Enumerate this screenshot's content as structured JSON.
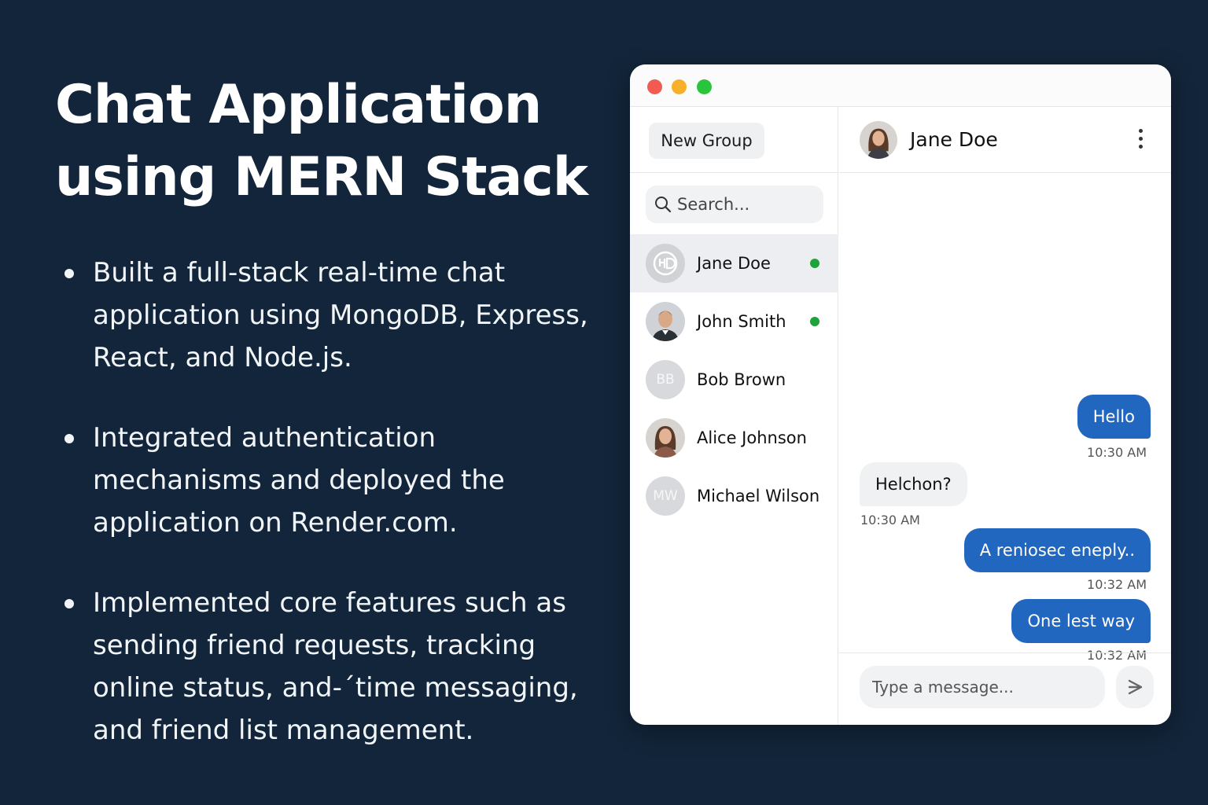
{
  "slide": {
    "title_line1": "Chat Application",
    "title_line2": "using MERN Stack",
    "bullets": [
      "Built a full-stack real-time chat application using MongoDB, Express, React, and Node.js.",
      "Integrated authentication mechanisms and deployed the application on Render.com.",
      "Implemented core features such as sending friend requests, tracking online status, and-´time messaging, and friend list management."
    ]
  },
  "sidebar": {
    "new_group_label": "New Group",
    "search_placeholder": "Search...",
    "contacts": [
      {
        "name": "Jane Doe",
        "online": true,
        "active": true,
        "avatar": "logo-icon"
      },
      {
        "name": "John Smith",
        "online": true,
        "active": false,
        "avatar": "photo"
      },
      {
        "name": "Bob Brown",
        "online": false,
        "active": false,
        "initials": "BB"
      },
      {
        "name": "Alice Johnson",
        "online": false,
        "active": false,
        "avatar": "photo"
      },
      {
        "name": "Michael Wilson",
        "online": false,
        "active": false,
        "initials": "MW"
      }
    ]
  },
  "chat": {
    "contact_name": "Jane Doe",
    "messages": [
      {
        "text": "Hello",
        "time": "10:30 AM",
        "direction": "out"
      },
      {
        "text": "Helchon?",
        "time": "10:30 AM",
        "direction": "in"
      },
      {
        "text": "A reniosec eneply..",
        "time": "10:32 AM",
        "direction": "out"
      },
      {
        "text": "One lest way",
        "time": "10:32 AM",
        "direction": "out"
      }
    ],
    "composer_placeholder": "Type a message..."
  },
  "colors": {
    "background": "#13253a",
    "outgoing_bubble": "#2167c0",
    "online_dot": "#1fa23a"
  }
}
